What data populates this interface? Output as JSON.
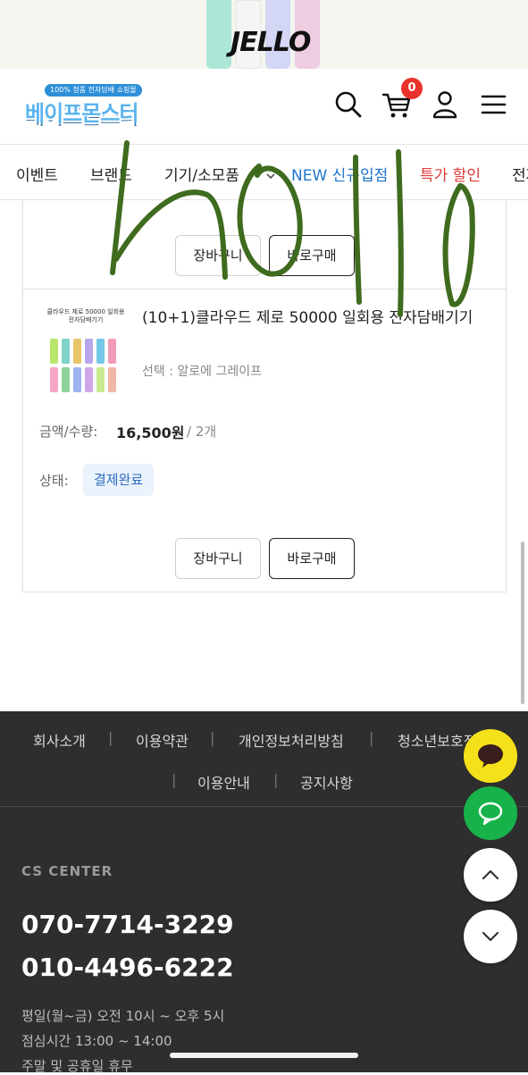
{
  "banner": {
    "brand": "JELLO",
    "device_colors": [
      "#9fe3d2",
      "#f3f7f5",
      "#cdd0f5",
      "#ecc6dd"
    ]
  },
  "header": {
    "logo_tagline": "100% 정품 전자담배 쇼핑몰",
    "logo_name": "베이프몬스터",
    "cart_count": "0",
    "icons": [
      "search-icon",
      "cart-icon",
      "user-icon",
      "menu-icon"
    ]
  },
  "nav": {
    "items": [
      {
        "label": "이벤트"
      },
      {
        "label": "브랜드"
      },
      {
        "label": "기기/소모품"
      },
      {
        "label": "NEW 신규입점"
      },
      {
        "label": "특가 할인"
      },
      {
        "label": "전자"
      }
    ]
  },
  "orders": [
    {
      "cart_button": "장바구니",
      "buy_button": "바로구매"
    },
    {
      "thumb_title": "클라우드 제로 50000 일회용 전자담배기기",
      "product_name": "(10+1)클라우드 제로 50000 일회용 전자담배기기",
      "option": "선택 : 알로에 그레이프",
      "amount_label": "금액/수량:",
      "amount": "16,500원",
      "qty": " / 2개",
      "status_label": "상태:",
      "status": "결제완료",
      "cart_button": "장바구니",
      "buy_button": "바로구매"
    }
  ],
  "footer": {
    "links": [
      "회사소개",
      "이용약관",
      "개인정보처리방침",
      "청소년보호정"
    ],
    "links2": [
      "이용안내",
      "공지사항"
    ],
    "separator": "|",
    "cs_title": "CS CENTER",
    "phones": [
      "070-7714-3229",
      "010-4496-6222"
    ],
    "hours": [
      "평일(월~금) 오전 10시 ~ 오후 5시",
      "점심시간 13:00 ~ 14:00",
      "주말 및 공휴일 휴무"
    ]
  },
  "floating": [
    "kakao-chat-icon",
    "talk-chat-icon",
    "scroll-up-icon",
    "scroll-down-icon"
  ],
  "colors": {
    "accent_blue": "#1f74c9",
    "sale_red": "#e03a3a",
    "badge_red": "#e8322b",
    "kakao_yellow": "#f6e019",
    "talk_green": "#17b24a",
    "doodle_green": "#3f6b1e"
  }
}
